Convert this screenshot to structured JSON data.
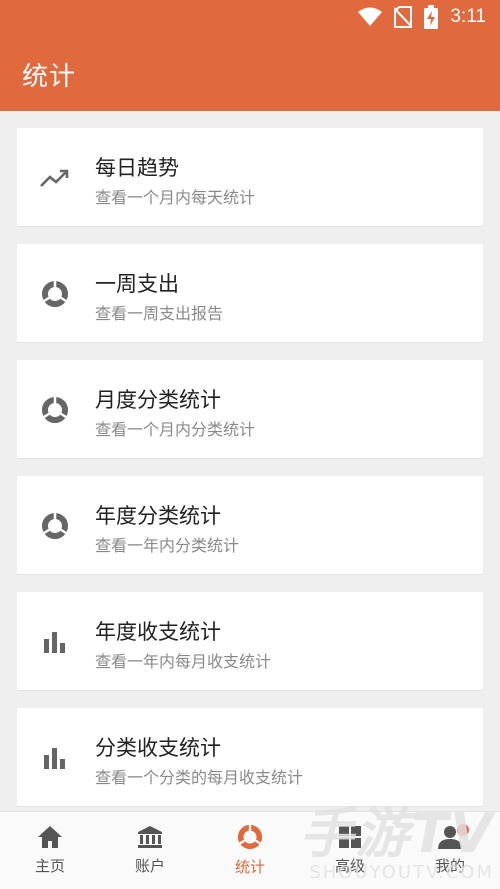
{
  "status_bar": {
    "time": "3:11"
  },
  "header": {
    "title": "统计"
  },
  "items": [
    {
      "title": "每日趋势",
      "subtitle": "查看一个月内每天统计",
      "icon": "trending-up-icon"
    },
    {
      "title": "一周支出",
      "subtitle": "查看一周支出报告",
      "icon": "pie-chart-icon"
    },
    {
      "title": "月度分类统计",
      "subtitle": "查看一个月内分类统计",
      "icon": "pie-chart-icon"
    },
    {
      "title": "年度分类统计",
      "subtitle": "查看一年内分类统计",
      "icon": "pie-chart-icon"
    },
    {
      "title": "年度收支统计",
      "subtitle": "查看一年内每月收支统计",
      "icon": "bar-chart-icon"
    },
    {
      "title": "分类收支统计",
      "subtitle": "查看一个分类的每月收支统计",
      "icon": "bar-chart-icon"
    }
  ],
  "bottom_nav": [
    {
      "label": "主页",
      "icon": "home-icon"
    },
    {
      "label": "账户",
      "icon": "bank-icon"
    },
    {
      "label": "统计",
      "icon": "pie-chart-icon",
      "active": true
    },
    {
      "label": "高级",
      "icon": "grid-icon"
    },
    {
      "label": "我的",
      "icon": "person-icon"
    }
  ],
  "watermark": {
    "main": "手游TV",
    "sub": "SHOUYOUTV.COM"
  },
  "colors": {
    "accent": "#e0693d",
    "background": "#efefef",
    "badge": "#ef5b5b"
  }
}
